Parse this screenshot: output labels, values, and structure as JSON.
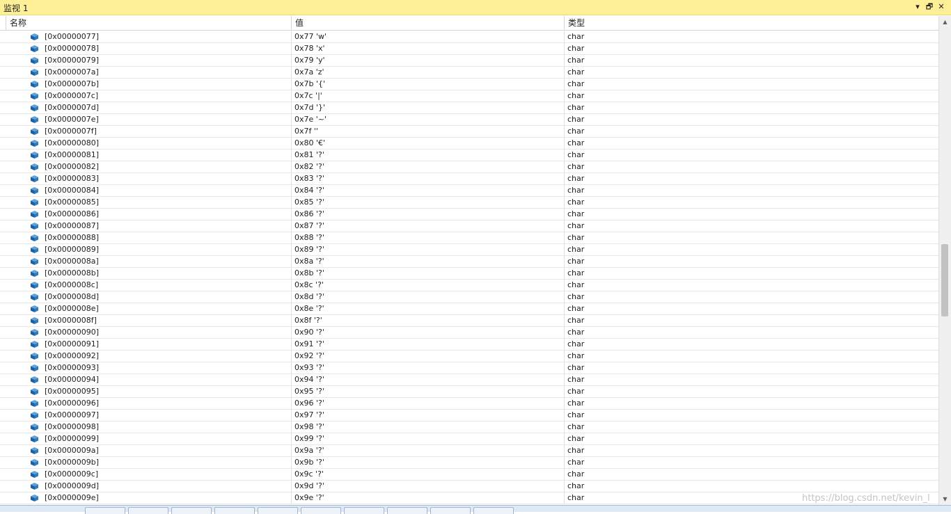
{
  "window": {
    "title": "监视 1",
    "controls": {
      "dropdown": "▾",
      "restore": "🗗",
      "close": "✕"
    }
  },
  "columns": {
    "name": "名称",
    "value": "值",
    "type": "类型"
  },
  "rows": [
    {
      "name": "[0x00000077]",
      "value": "0x77 'w'",
      "type": "char"
    },
    {
      "name": "[0x00000078]",
      "value": "0x78 'x'",
      "type": "char"
    },
    {
      "name": "[0x00000079]",
      "value": "0x79 'y'",
      "type": "char"
    },
    {
      "name": "[0x0000007a]",
      "value": "0x7a 'z'",
      "type": "char"
    },
    {
      "name": "[0x0000007b]",
      "value": "0x7b '{'",
      "type": "char"
    },
    {
      "name": "[0x0000007c]",
      "value": "0x7c '|'",
      "type": "char"
    },
    {
      "name": "[0x0000007d]",
      "value": "0x7d '}'",
      "type": "char"
    },
    {
      "name": "[0x0000007e]",
      "value": "0x7e '~'",
      "type": "char"
    },
    {
      "name": "[0x0000007f]",
      "value": "0x7f ''",
      "type": "char"
    },
    {
      "name": "[0x00000080]",
      "value": "0x80 '€'",
      "type": "char"
    },
    {
      "name": "[0x00000081]",
      "value": "0x81 '?'",
      "type": "char"
    },
    {
      "name": "[0x00000082]",
      "value": "0x82 '?'",
      "type": "char"
    },
    {
      "name": "[0x00000083]",
      "value": "0x83 '?'",
      "type": "char"
    },
    {
      "name": "[0x00000084]",
      "value": "0x84 '?'",
      "type": "char"
    },
    {
      "name": "[0x00000085]",
      "value": "0x85 '?'",
      "type": "char"
    },
    {
      "name": "[0x00000086]",
      "value": "0x86 '?'",
      "type": "char"
    },
    {
      "name": "[0x00000087]",
      "value": "0x87 '?'",
      "type": "char"
    },
    {
      "name": "[0x00000088]",
      "value": "0x88 '?'",
      "type": "char"
    },
    {
      "name": "[0x00000089]",
      "value": "0x89 '?'",
      "type": "char"
    },
    {
      "name": "[0x0000008a]",
      "value": "0x8a '?'",
      "type": "char"
    },
    {
      "name": "[0x0000008b]",
      "value": "0x8b '?'",
      "type": "char"
    },
    {
      "name": "[0x0000008c]",
      "value": "0x8c '?'",
      "type": "char"
    },
    {
      "name": "[0x0000008d]",
      "value": "0x8d '?'",
      "type": "char"
    },
    {
      "name": "[0x0000008e]",
      "value": "0x8e '?'",
      "type": "char"
    },
    {
      "name": "[0x0000008f]",
      "value": "0x8f '?'",
      "type": "char"
    },
    {
      "name": "[0x00000090]",
      "value": "0x90 '?'",
      "type": "char"
    },
    {
      "name": "[0x00000091]",
      "value": "0x91 '?'",
      "type": "char"
    },
    {
      "name": "[0x00000092]",
      "value": "0x92 '?'",
      "type": "char"
    },
    {
      "name": "[0x00000093]",
      "value": "0x93 '?'",
      "type": "char"
    },
    {
      "name": "[0x00000094]",
      "value": "0x94 '?'",
      "type": "char"
    },
    {
      "name": "[0x00000095]",
      "value": "0x95 '?'",
      "type": "char"
    },
    {
      "name": "[0x00000096]",
      "value": "0x96 '?'",
      "type": "char"
    },
    {
      "name": "[0x00000097]",
      "value": "0x97 '?'",
      "type": "char"
    },
    {
      "name": "[0x00000098]",
      "value": "0x98 '?'",
      "type": "char"
    },
    {
      "name": "[0x00000099]",
      "value": "0x99 '?'",
      "type": "char"
    },
    {
      "name": "[0x0000009a]",
      "value": "0x9a '?'",
      "type": "char"
    },
    {
      "name": "[0x0000009b]",
      "value": "0x9b '?'",
      "type": "char"
    },
    {
      "name": "[0x0000009c]",
      "value": "0x9c '?'",
      "type": "char"
    },
    {
      "name": "[0x0000009d]",
      "value": "0x9d '?'",
      "type": "char"
    },
    {
      "name": "[0x0000009e]",
      "value": "0x9e '?'",
      "type": "char"
    }
  ],
  "watermark": "https://blog.csdn.net/kevin_l",
  "icons": {
    "row": "object-cube-icon"
  }
}
